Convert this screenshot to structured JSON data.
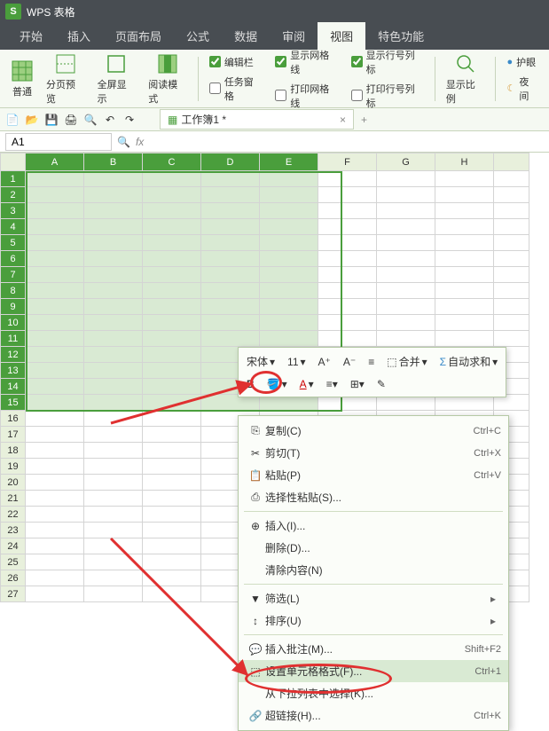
{
  "titlebar": {
    "app_name": "WPS 表格"
  },
  "tabs": {
    "items": [
      "开始",
      "插入",
      "页面布局",
      "公式",
      "数据",
      "审阅",
      "视图",
      "特色功能"
    ],
    "active": "视图"
  },
  "ribbon": {
    "btn_normal": "普通",
    "btn_pagebreak": "分页预览",
    "btn_fullscreen": "全屏显示",
    "btn_readmode": "阅读模式",
    "chk_editbar": "编辑栏",
    "chk_taskpane": "任务窗格",
    "chk_gridlines": "显示网格线",
    "chk_print_grid": "打印网格线",
    "chk_rowcol": "显示行号列标",
    "chk_print_rowcol": "打印行号列标",
    "btn_zoom": "显示比例",
    "btn_eye": "护眼",
    "btn_night": "夜间"
  },
  "doc": {
    "tab_title": "工作簿1 *"
  },
  "namebox": {
    "value": "A1"
  },
  "columns": [
    "A",
    "B",
    "C",
    "D",
    "E",
    "F",
    "G",
    "H"
  ],
  "rows_count": 27,
  "mini_toolbar": {
    "font": "宋体",
    "size": "11",
    "merge": "合并",
    "autosum": "自动求和"
  },
  "context_menu": {
    "copy": "复制(C)",
    "copy_sc": "Ctrl+C",
    "cut": "剪切(T)",
    "cut_sc": "Ctrl+X",
    "paste": "粘贴(P)",
    "paste_sc": "Ctrl+V",
    "paste_special": "选择性粘贴(S)...",
    "insert": "插入(I)...",
    "delete": "删除(D)...",
    "clear": "清除内容(N)",
    "filter": "筛选(L)",
    "sort": "排序(U)",
    "comment": "插入批注(M)...",
    "comment_sc": "Shift+F2",
    "format_cells": "设置单元格格式(F)...",
    "format_cells_sc": "Ctrl+1",
    "dropdown": "从下拉列表中选择(K)...",
    "hyperlink": "超链接(H)...",
    "hyperlink_sc": "Ctrl+K"
  }
}
